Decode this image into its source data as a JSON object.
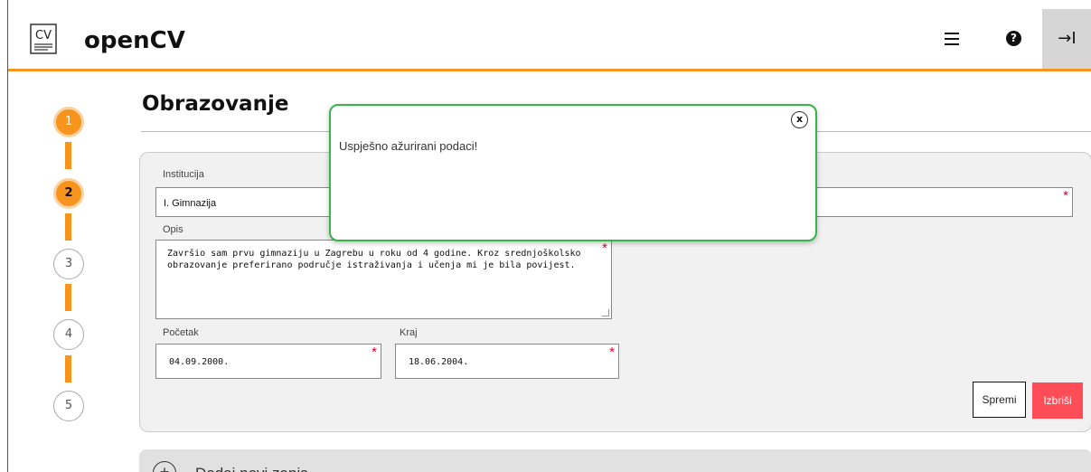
{
  "header": {
    "logo_text": "CV",
    "brand": "openCV",
    "help_symbol": "?",
    "logout_symbol": "→I",
    "accent_color": "#f7941d"
  },
  "stepper": {
    "steps": [
      {
        "label": "1",
        "state": "done"
      },
      {
        "label": "2",
        "state": "active"
      },
      {
        "label": "3",
        "state": "todo"
      },
      {
        "label": "4",
        "state": "todo"
      },
      {
        "label": "5",
        "state": "todo"
      }
    ]
  },
  "page": {
    "title": "Obrazovanje"
  },
  "form": {
    "institution_label": "Institucija",
    "institution_value": "I. Gimnazija",
    "description_label": "Opis",
    "description_value": "Završio sam prvu gimnaziju u Zagrebu u roku od 4 godine. Kroz srednjoškolsko\nobrazovanje preferirano područje istraživanja i učenja mi je bila povijest.",
    "start_label": "Početak",
    "start_value": "04.09.2000.",
    "end_label": "Kraj",
    "end_value": "18.06.2004.",
    "required_mark": "*",
    "save_label": "Spremi",
    "delete_label": "Izbriši",
    "delete_color": "#ff4d57"
  },
  "add_entry": {
    "icon": "+",
    "label": "Dodaj novi zapis"
  },
  "modal": {
    "message": "Uspješno ažurirani podaci!",
    "close_label": "x",
    "border_color": "#39b54a"
  }
}
